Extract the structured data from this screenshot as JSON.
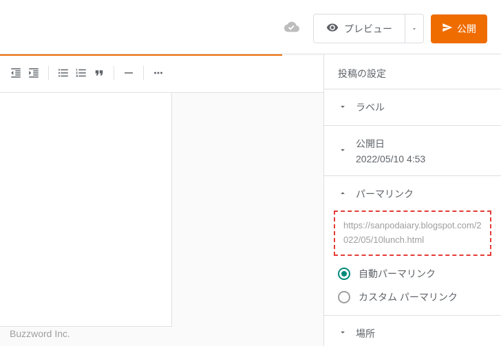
{
  "header": {
    "preview_label": "プレビュー",
    "publish_label": "公開"
  },
  "sidebar": {
    "title": "投稿の設定",
    "sections": {
      "labels": {
        "label": "ラベル"
      },
      "published": {
        "label": "公開日",
        "value": "2022/05/10 4:53"
      },
      "permalink": {
        "label": "パーマリンク",
        "url": "https://sanpodaiary.blogspot.com/2022/05/10lunch.html",
        "auto_label": "自動パーマリンク",
        "custom_label": "カスタム パーマリンク"
      },
      "location": {
        "label": "場所"
      }
    }
  },
  "footer": {
    "text": "Buzzword Inc."
  }
}
